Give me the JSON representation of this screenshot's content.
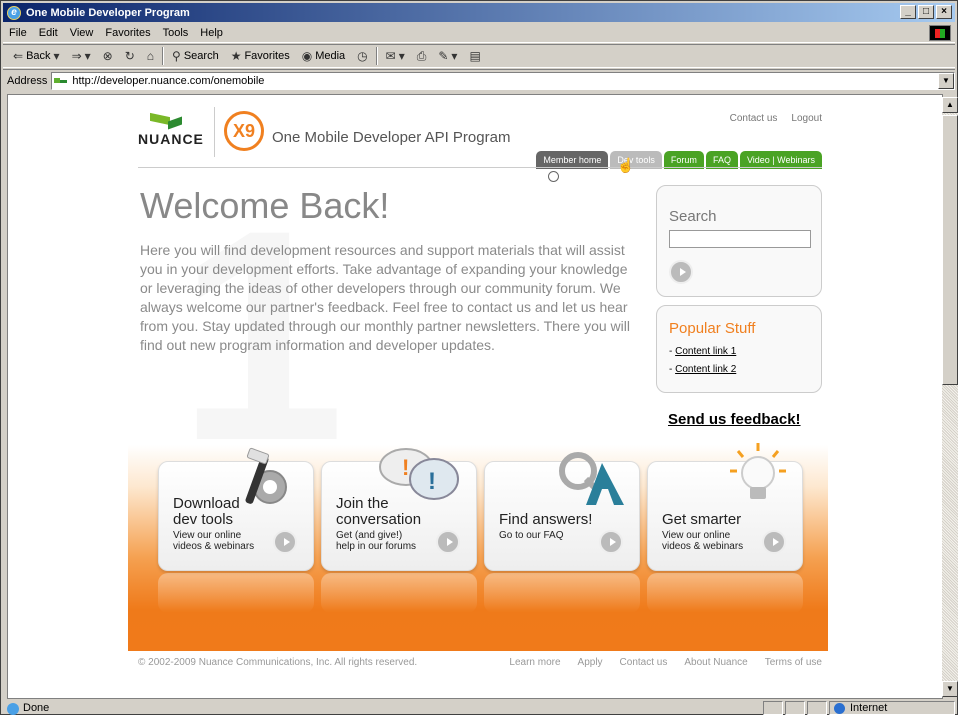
{
  "window": {
    "title": "One Mobile Developer Program"
  },
  "menu": [
    "File",
    "Edit",
    "View",
    "Favorites",
    "Tools",
    "Help"
  ],
  "toolbar": {
    "back": "Back",
    "search": "Search",
    "favorites": "Favorites",
    "media": "Media"
  },
  "address": {
    "label": "Address",
    "url": "http://developer.nuance.com/onemobile"
  },
  "status": {
    "text": "Done",
    "zone": "Internet"
  },
  "page": {
    "brand": "NUANCE",
    "logo_mark": "X9",
    "program_name": "One Mobile Developer API Program",
    "top_links": [
      "Contact us",
      "Logout"
    ],
    "nav_tabs": [
      "Member home",
      "Dev tools",
      "Forum",
      "FAQ",
      "Video | Webinars"
    ],
    "welcome": "Welcome Back!",
    "intro": "Here you will find development resources and support materials that will assist you in your development efforts. Take advantage of expanding your knowledge or leveraging the ideas of other developers through our community forum. We always welcome our partner's feedback. Feel free to contact us and let us hear from you. Stay updated through our monthly partner newsletters. There you will find out new program information and developer updates.",
    "search": {
      "title": "Search",
      "value": ""
    },
    "popular": {
      "title": "Popular Stuff",
      "links": [
        "Content link 1",
        "Content link 2"
      ]
    },
    "feedback": "Send us feedback!",
    "cards": [
      {
        "title": [
          "Download",
          "dev tools"
        ],
        "sub": [
          "View our online",
          "videos & webinars"
        ]
      },
      {
        "title": [
          "Join the",
          "conversation"
        ],
        "sub": [
          "Get (and give!)",
          "help in our forums"
        ]
      },
      {
        "title": [
          "Find answers!"
        ],
        "sub": [
          "Go to our FAQ"
        ]
      },
      {
        "title": [
          "Get smarter"
        ],
        "sub": [
          "View our online",
          "videos & webinars"
        ]
      }
    ],
    "footer": {
      "copyright": "© 2002-2009 Nuance Communications, Inc. All rights reserved.",
      "links": [
        "Learn more",
        "Apply",
        "Contact us",
        "About Nuance",
        "Terms of use"
      ]
    },
    "colors": {
      "orange": "#f07a1a",
      "green": "#4aa324",
      "gray_tab": "#666666"
    }
  }
}
